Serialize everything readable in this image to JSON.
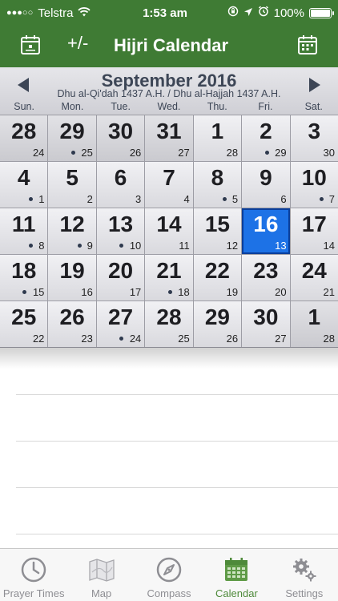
{
  "status_bar": {
    "signal": "●●●○○",
    "carrier": "Telstra",
    "time": "1:53 am",
    "battery": "100%"
  },
  "nav": {
    "plus_minus": "+/-",
    "title": "Hijri Calendar"
  },
  "calendar": {
    "month_title": "September 2016",
    "hijri_range": "Dhu al-Qi'dah 1437 A.H. / Dhu al-Hajjah 1437 A.H.",
    "weekdays": [
      "Sun.",
      "Mon.",
      "Tue.",
      "Wed.",
      "Thu.",
      "Fri.",
      "Sat."
    ],
    "weeks": [
      [
        {
          "g": "28",
          "h": "24",
          "dot": false,
          "other": true
        },
        {
          "g": "29",
          "h": "25",
          "dot": true,
          "other": true
        },
        {
          "g": "30",
          "h": "26",
          "dot": false,
          "other": true
        },
        {
          "g": "31",
          "h": "27",
          "dot": false,
          "other": true
        },
        {
          "g": "1",
          "h": "28",
          "dot": false,
          "other": false
        },
        {
          "g": "2",
          "h": "29",
          "dot": true,
          "other": false
        },
        {
          "g": "3",
          "h": "30",
          "dot": false,
          "other": false
        }
      ],
      [
        {
          "g": "4",
          "h": "1",
          "dot": true,
          "other": false
        },
        {
          "g": "5",
          "h": "2",
          "dot": false,
          "other": false
        },
        {
          "g": "6",
          "h": "3",
          "dot": false,
          "other": false
        },
        {
          "g": "7",
          "h": "4",
          "dot": false,
          "other": false
        },
        {
          "g": "8",
          "h": "5",
          "dot": true,
          "other": false
        },
        {
          "g": "9",
          "h": "6",
          "dot": false,
          "other": false
        },
        {
          "g": "10",
          "h": "7",
          "dot": true,
          "other": false
        }
      ],
      [
        {
          "g": "11",
          "h": "8",
          "dot": true,
          "other": false
        },
        {
          "g": "12",
          "h": "9",
          "dot": true,
          "other": false
        },
        {
          "g": "13",
          "h": "10",
          "dot": true,
          "other": false
        },
        {
          "g": "14",
          "h": "11",
          "dot": false,
          "other": false
        },
        {
          "g": "15",
          "h": "12",
          "dot": false,
          "other": false
        },
        {
          "g": "16",
          "h": "13",
          "dot": false,
          "other": false,
          "selected": true
        },
        {
          "g": "17",
          "h": "14",
          "dot": false,
          "other": false
        }
      ],
      [
        {
          "g": "18",
          "h": "15",
          "dot": true,
          "other": false
        },
        {
          "g": "19",
          "h": "16",
          "dot": false,
          "other": false
        },
        {
          "g": "20",
          "h": "17",
          "dot": false,
          "other": false
        },
        {
          "g": "21",
          "h": "18",
          "dot": true,
          "other": false
        },
        {
          "g": "22",
          "h": "19",
          "dot": false,
          "other": false
        },
        {
          "g": "23",
          "h": "20",
          "dot": false,
          "other": false
        },
        {
          "g": "24",
          "h": "21",
          "dot": false,
          "other": false
        }
      ],
      [
        {
          "g": "25",
          "h": "22",
          "dot": false,
          "other": false
        },
        {
          "g": "26",
          "h": "23",
          "dot": false,
          "other": false
        },
        {
          "g": "27",
          "h": "24",
          "dot": true,
          "other": false
        },
        {
          "g": "28",
          "h": "25",
          "dot": false,
          "other": false
        },
        {
          "g": "29",
          "h": "26",
          "dot": false,
          "other": false
        },
        {
          "g": "30",
          "h": "27",
          "dot": false,
          "other": false
        },
        {
          "g": "1",
          "h": "28",
          "dot": false,
          "other": true
        }
      ]
    ]
  },
  "tabs": [
    {
      "label": "Prayer Times",
      "icon": "clock-icon",
      "active": false
    },
    {
      "label": "Map",
      "icon": "map-icon",
      "active": false
    },
    {
      "label": "Compass",
      "icon": "compass-icon",
      "active": false
    },
    {
      "label": "Calendar",
      "icon": "calendar-icon",
      "active": true
    },
    {
      "label": "Settings",
      "icon": "gear-icon",
      "active": false
    }
  ],
  "colors": {
    "bar_green": "#3f7b34",
    "selected_blue": "#1d72e6",
    "active_tab": "#4e8a3a",
    "inactive_tab": "#8e8e93"
  }
}
